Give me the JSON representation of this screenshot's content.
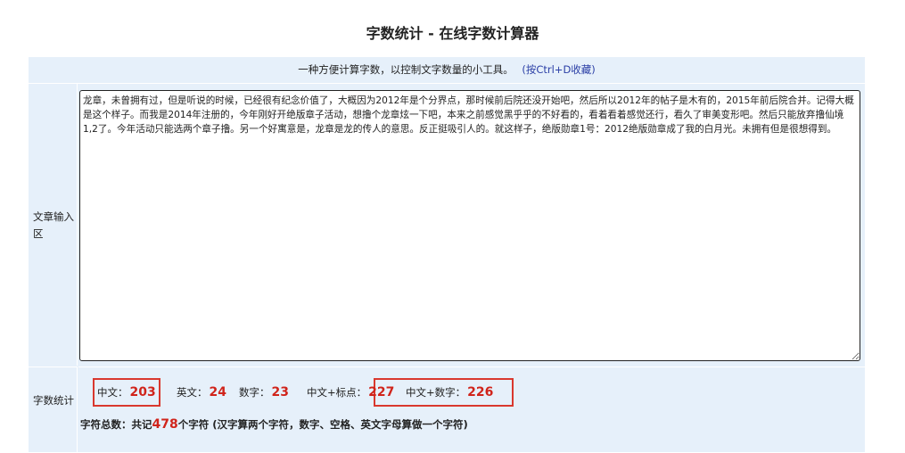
{
  "page": {
    "title": "字数统计 - 在线字数计算器"
  },
  "tool": {
    "subtitle": "一种方便计算字数，以控制文字数量的小工具。",
    "favorite_hint": "(按Ctrl+D收藏)",
    "input_label": "文章输入区",
    "article_text": "龙章，未曾拥有过，但是听说的时候，已经很有纪念价值了，大概因为2012年是个分界点，那时候前后院还没开始吧，然后所以2012年的帖子是木有的，2015年前后院合并。记得大概是这个样子。而我是2014年注册的，今年刚好开绝版章子活动，想撸个龙章炫一下吧，本来之前感觉黑乎乎的不好看的，看着看着感觉还行，看久了审美变形吧。然后只能放弃撸仙境1,2了。今年活动只能选两个章子撸。另一个好寓意是，龙章是龙的传人的意思。反正挺吸引人的。就这样子，绝版勋章1号：2012绝版勋章成了我的白月光。未拥有但是很想得到。",
    "stats_label": "字数统计",
    "stats": {
      "chinese_label": "中文：",
      "chinese_value": "203",
      "english_label": "英文：",
      "english_value": "24",
      "digits_label": "数字：",
      "digits_value": "23",
      "chinese_punct_label": "中文+标点：",
      "chinese_punct_value": "227",
      "chinese_digits_label": "中文+数字：",
      "chinese_digits_value": "226"
    },
    "total": {
      "prefix": "字符总数：共记",
      "value": "478",
      "suffix": "个字符 (汉字算两个字符，数字、空格、英文字母算做一个字符)"
    }
  },
  "colors": {
    "panel_bg": "#e6f0fa",
    "highlight_box": "#d9382e",
    "number_red": "#d0241b",
    "link_blue": "#2b3fa6"
  }
}
